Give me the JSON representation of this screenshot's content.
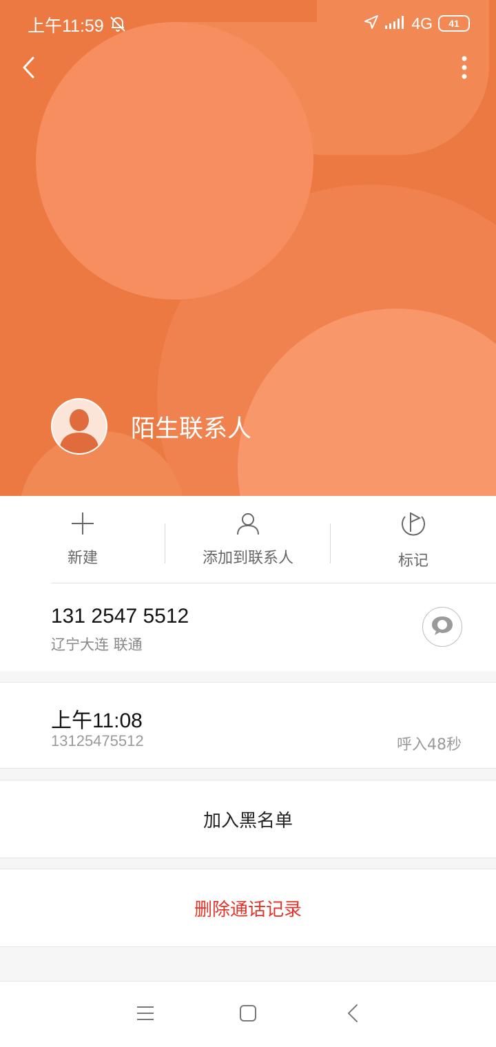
{
  "status_bar": {
    "time": "上午11:59",
    "network": "4G",
    "battery": "41",
    "icons": [
      "bell-off-icon",
      "location-icon",
      "signal-icon",
      "battery-icon"
    ]
  },
  "header": {
    "background_color": "#ec7842",
    "contact_name": "陌生联系人",
    "icons": [
      "back-icon",
      "more-icon",
      "avatar-icon"
    ]
  },
  "actions": [
    {
      "label": "新建",
      "icon": "plus-icon"
    },
    {
      "label": "添加到联系人",
      "icon": "person-icon"
    },
    {
      "label": "标记",
      "icon": "flag-icon"
    }
  ],
  "phone": {
    "number": "131 2547 5512",
    "location": "辽宁大连 联通",
    "icon": "message-icon"
  },
  "call_log": {
    "time": "上午11:08",
    "number": "13125475512",
    "duration": "呼入48秒"
  },
  "buttons": {
    "blacklist": "加入黑名单",
    "delete": "删除通话记录",
    "delete_color": "#e4342a"
  },
  "nav_bar": {
    "icons": [
      "menu-icon",
      "home-icon",
      "nav-back-icon"
    ]
  }
}
